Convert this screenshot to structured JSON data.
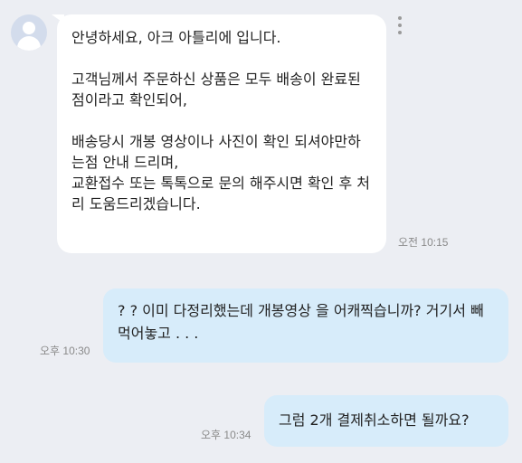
{
  "messages": [
    {
      "direction": "incoming",
      "text": "안녕하세요, 아크 아틀리에 입니다.\n\n고객님께서 주문하신 상품은 모두 배송이 완료된 점이라고 확인되어,\n\n배송당시 개봉 영상이나 사진이 확인 되셔야만하는점 안내 드리며,\n교환접수 또는 톡톡으로 문의 해주시면 확인 후 처리 도움드리겠습니다.",
      "time": "오전 10:15"
    },
    {
      "direction": "outgoing",
      "text": "? ? 이미 다정리했는데 개봉영상 을 어캐찍습니까? 거기서 빼먹어놓고 . . .",
      "time": "오후 10:30"
    },
    {
      "direction": "outgoing",
      "text": "그럼 2개 결제취소하면 될까요?",
      "time": "오후 10:34"
    }
  ]
}
